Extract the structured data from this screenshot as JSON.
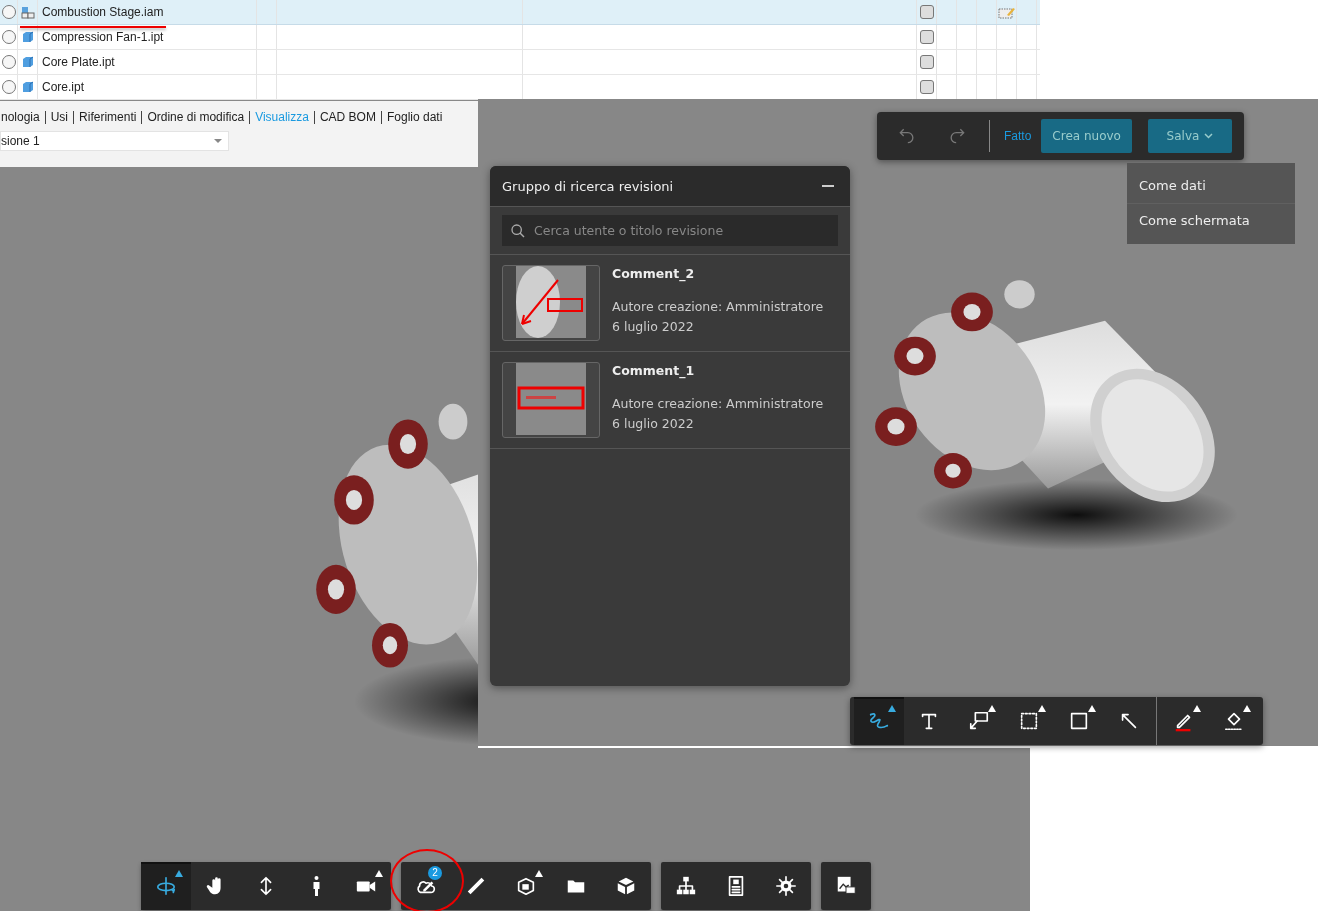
{
  "file_list": {
    "rows": [
      {
        "name": "Combustion Stage.iam",
        "kind": "assembly",
        "selected": true,
        "has_edit_icon": true
      },
      {
        "name": "Compression Fan-1.ipt",
        "kind": "part",
        "selected": false,
        "has_edit_icon": false
      },
      {
        "name": "Core Plate.ipt",
        "kind": "part",
        "selected": false,
        "has_edit_icon": false
      },
      {
        "name": "Core.ipt",
        "kind": "part",
        "selected": false,
        "has_edit_icon": false
      }
    ]
  },
  "tabs": [
    {
      "label": "nologia",
      "selected": false
    },
    {
      "label": "Usi",
      "selected": false
    },
    {
      "label": "Riferimenti",
      "selected": false
    },
    {
      "label": "Ordine di modifica",
      "selected": false
    },
    {
      "label": "Visualizza",
      "selected": true
    },
    {
      "label": "CAD BOM",
      "selected": false
    },
    {
      "label": "Foglio dati",
      "selected": false
    }
  ],
  "version_select": {
    "value": "sione 1"
  },
  "markup_bar": {
    "done_label": "Fatto",
    "create_label": "Crea nuovo",
    "save_label": "Salva"
  },
  "save_menu": {
    "items": [
      "Come dati",
      "Come schermata"
    ]
  },
  "review_panel": {
    "title": "Gruppo di ricerca revisioni",
    "search": {
      "placeholder": "Cerca utente o titolo revisione"
    },
    "comments": [
      {
        "title": "Comment_2",
        "author": "Autore creazione: Amministratore",
        "date": "6 luglio 2022"
      },
      {
        "title": "Comment_1",
        "author": "Autore creazione: Amministratore",
        "date": "6 luglio 2022"
      }
    ]
  },
  "draw_tools": {
    "groups": [
      [
        {
          "kind": "freehand",
          "selected": true,
          "has_menu": true
        },
        {
          "kind": "text",
          "selected": false,
          "has_menu": false
        },
        {
          "kind": "callout",
          "selected": false,
          "has_menu": true
        },
        {
          "kind": "cloud",
          "selected": false,
          "has_menu": true
        },
        {
          "kind": "rectangle",
          "selected": false,
          "has_menu": true
        },
        {
          "kind": "arrow",
          "selected": false,
          "has_menu": false
        }
      ],
      [
        {
          "kind": "pen",
          "selected": false,
          "has_menu": true
        },
        {
          "kind": "fill",
          "selected": false,
          "has_menu": true
        }
      ]
    ]
  },
  "nav_toolbar": {
    "groups": [
      [
        {
          "kind": "orbit",
          "selected": true,
          "has_menu": true
        },
        {
          "kind": "pan",
          "selected": false,
          "has_menu": false
        },
        {
          "kind": "zoom",
          "selected": false,
          "has_menu": false
        },
        {
          "kind": "walk",
          "selected": false,
          "has_menu": false
        },
        {
          "kind": "camera",
          "selected": false,
          "has_menu": true
        }
      ],
      [
        {
          "kind": "markup",
          "selected": false,
          "has_menu": false,
          "badge": "2"
        },
        {
          "kind": "measure",
          "selected": false,
          "has_menu": false
        },
        {
          "kind": "section",
          "selected": false,
          "has_menu": true
        },
        {
          "kind": "folder",
          "selected": false,
          "has_menu": false
        },
        {
          "kind": "explode",
          "selected": false,
          "has_menu": false
        }
      ],
      [
        {
          "kind": "structure",
          "selected": false,
          "has_menu": false
        },
        {
          "kind": "properties",
          "selected": false,
          "has_menu": false
        },
        {
          "kind": "settings",
          "selected": false,
          "has_menu": false
        }
      ],
      [
        {
          "kind": "print",
          "selected": false,
          "has_menu": false
        }
      ]
    ]
  }
}
